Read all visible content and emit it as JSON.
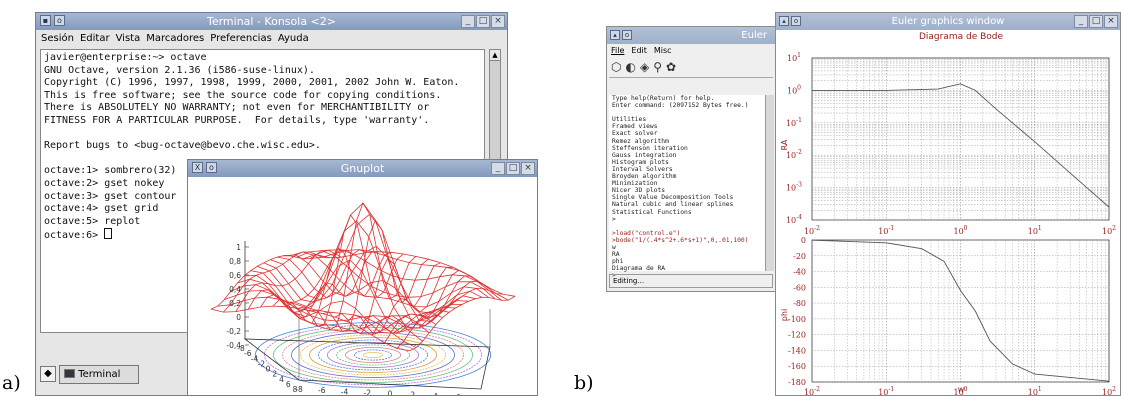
{
  "captions": {
    "a": "a)",
    "b": "b)"
  },
  "konsole": {
    "title": "Terminal - Konsola <2>",
    "menu": [
      "Sesión",
      "Editar",
      "Vista",
      "Marcadores",
      "Preferencias",
      "Ayuda"
    ],
    "lines": [
      "javier@enterprise:~> octave",
      "GNU Octave, version 2.1.36 (i586-suse-linux).",
      "Copyright (C) 1996, 1997, 1998, 1999, 2000, 2001, 2002 John W. Eaton.",
      "This is free software; see the source code for copying conditions.",
      "There is ABSOLUTELY NO WARRANTY; not even for MERCHANTIBILITY or",
      "FITNESS FOR A PARTICULAR PURPOSE.  For details, type 'warranty'.",
      "",
      "Report bugs to <bug-octave@bevo.che.wisc.edu>.",
      "",
      "octave:1> sombrero(32)",
      "octave:2> gset nokey",
      "octave:3> gset contour",
      "octave:4> gset grid",
      "octave:5> replot",
      "octave:6> "
    ],
    "tab_label": "Terminal"
  },
  "gnuplot": {
    "title": "Gnuplot",
    "z_ticks": [
      "1",
      "0,8",
      "0,6",
      "0,4",
      "0,2",
      "0",
      "-0,2",
      "-0,4"
    ],
    "x_ticks": [
      "-8",
      "-6",
      "-4",
      "-2",
      "0",
      "2",
      "4",
      "6",
      "8"
    ],
    "y_ticks": [
      "-8",
      "-6",
      "-4",
      "-2",
      "0",
      "2",
      "4",
      "6",
      "8"
    ]
  },
  "euler_main": {
    "title": "Euler",
    "menu": [
      "File",
      "Edit",
      "Misc"
    ],
    "lines": [
      "Type help(Return) for help.",
      "Enter command: (2097152 Bytes free.)",
      "",
      "Utilities",
      "Framed views",
      "Exact solver",
      "Remez algorithm",
      "Steffenson iteration",
      "Gauss integration",
      "Histogram plots",
      "Interval Solvers",
      "Broyden algorithm",
      "Minimization",
      "Nicer 3D plots",
      "Single Value Decomposition Tools",
      "Natural cubic and linear splines",
      "Statistical Functions",
      ">"
    ],
    "cmd_lines": [
      ">load(\"control.e\")",
      ">bode(\"1/(.4*s^2+.6*s+1)\",0,.01,100)"
    ],
    "output_lines": [
      "w",
      "RA",
      "phi",
      "Diagrama de RA",
      ">"
    ],
    "status": "Editing..."
  },
  "euler_graphics": {
    "title": "Euler graphics window",
    "plot_title": "Diagrama de Bode",
    "top_ylabel": "RA",
    "bottom_ylabel": "phi",
    "xlabel": "w",
    "top_yticks": [
      "10^1",
      "10^0",
      "10^-1",
      "10^-2",
      "10^-3",
      "10^-4"
    ],
    "bottom_yticks": [
      "0",
      "-20",
      "-40",
      "-60",
      "-80",
      "-100",
      "-120",
      "-140",
      "-160",
      "-180"
    ],
    "xticks": [
      "10^-2",
      "10^-1",
      "10^0",
      "10^1",
      "10^2"
    ]
  },
  "colors": {
    "kde_title": "#8399bd",
    "euler_red": "#9a2020",
    "gnuplot_mesh": "#e03030"
  },
  "chart_data": [
    {
      "type": "line",
      "title": "Diagrama de Bode",
      "xlabel": "",
      "ylabel": "RA",
      "xscale": "log",
      "yscale": "log",
      "xlim": [
        0.01,
        100
      ],
      "ylim": [
        0.0001,
        10
      ],
      "series": [
        {
          "x": [
            0.01,
            0.1,
            0.5,
            1,
            1.58,
            3,
            10,
            30,
            100
          ],
          "y": [
            1.0,
            1.0,
            1.1,
            1.6,
            1.0,
            0.27,
            0.026,
            0.0028,
            0.00025
          ]
        }
      ]
    },
    {
      "type": "line",
      "title": "",
      "xlabel": "w",
      "ylabel": "phi",
      "xscale": "log",
      "xlim": [
        0.01,
        100
      ],
      "ylim": [
        -180,
        0
      ],
      "series": [
        {
          "x": [
            0.01,
            0.1,
            0.3,
            0.6,
            1,
            1.58,
            2.5,
            5,
            10,
            100
          ],
          "y": [
            -0.3,
            -3.5,
            -11,
            -27,
            -64,
            -90,
            -128,
            -157,
            -170,
            -179
          ]
        }
      ]
    }
  ]
}
